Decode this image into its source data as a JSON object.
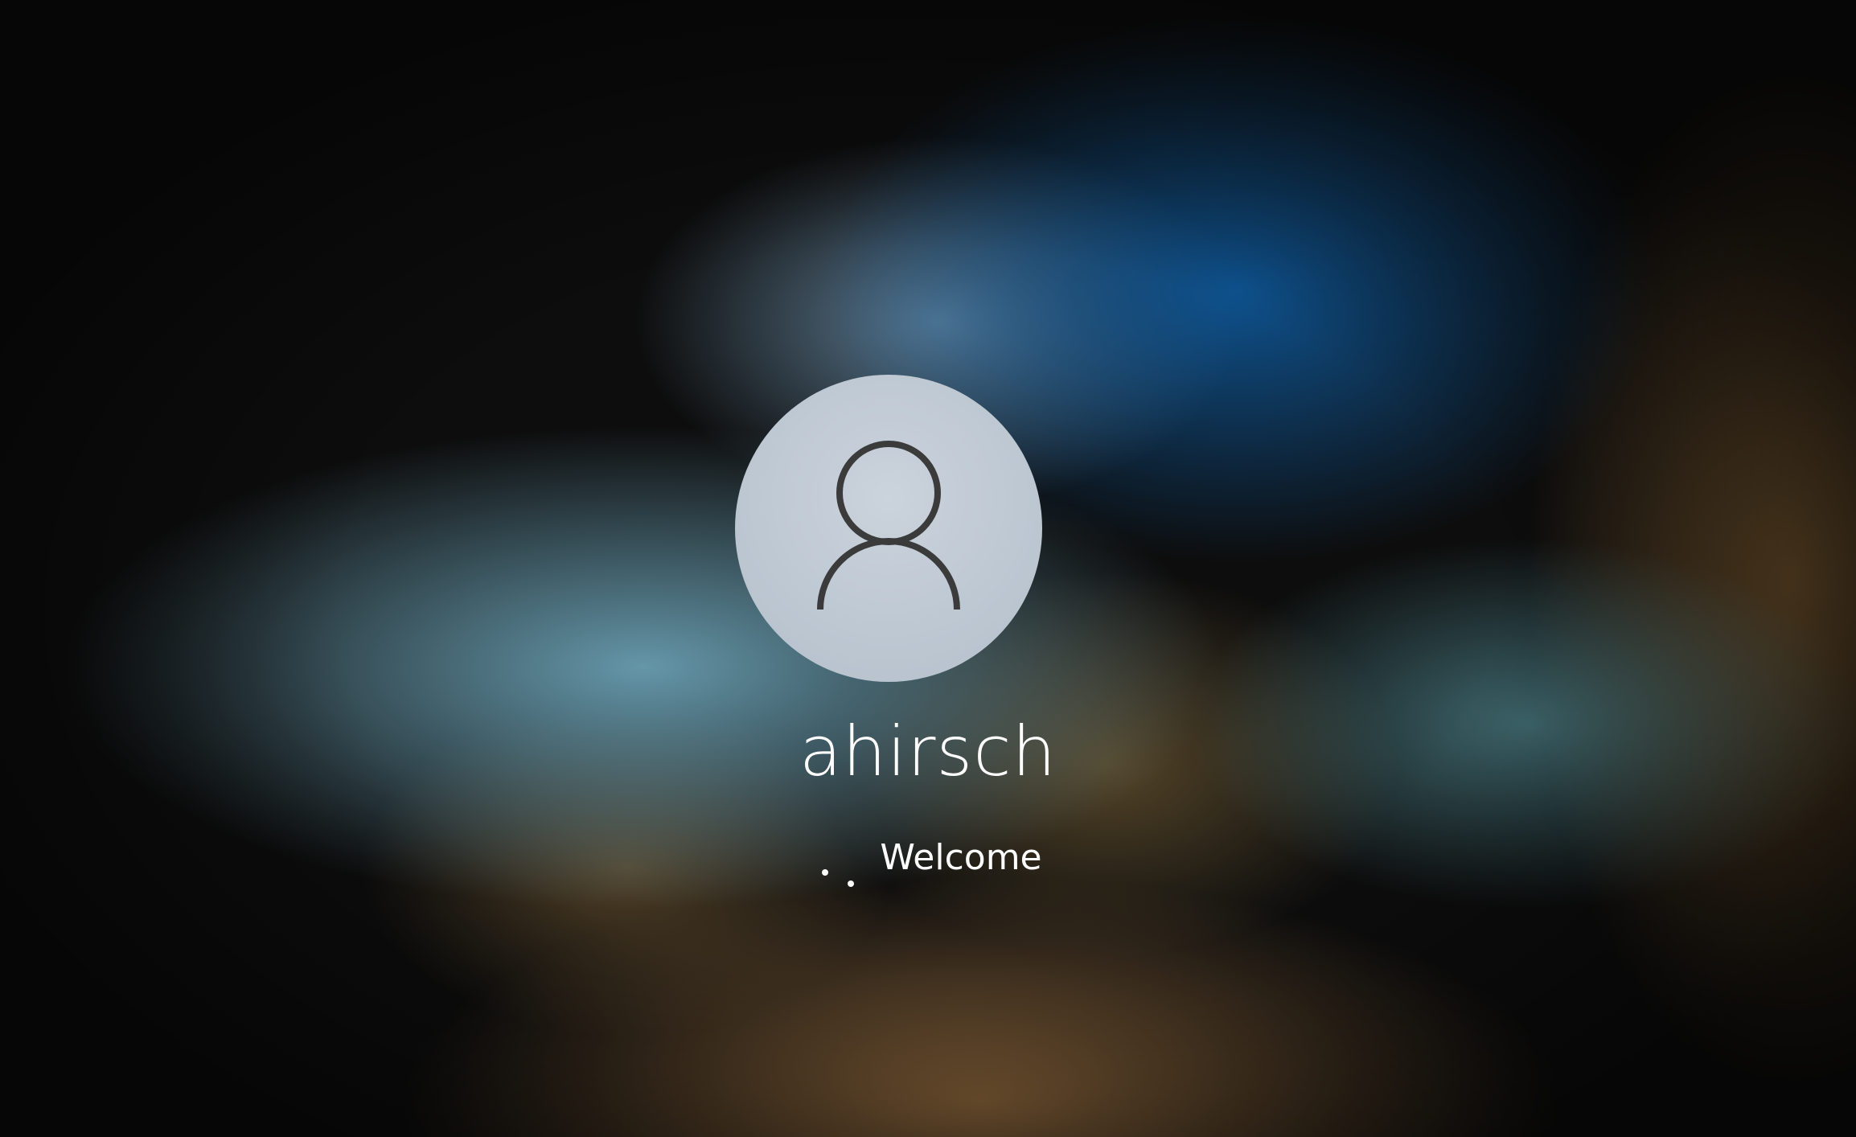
{
  "login": {
    "username": "ahirsch",
    "status_text": "Welcome",
    "avatar_icon": "user-silhouette-icon",
    "spinner_icon": "loading-dots-icon"
  },
  "colors": {
    "avatar_bg": "#bfc8d2",
    "avatar_stroke": "#3b3b3b",
    "text": "#ffffff",
    "wallpaper_blue": "#0e5696",
    "wallpaper_teal": "#6ca2b6",
    "wallpaper_brown": "#8a643a"
  }
}
